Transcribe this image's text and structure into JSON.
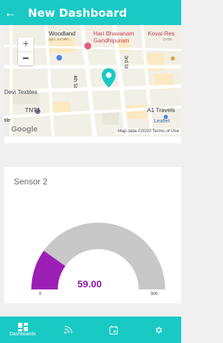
{
  "app_bar": {
    "title": "New Dashboard",
    "back_icon": "arrow-left-icon"
  },
  "map": {
    "labels": {
      "woodland": "Woodland",
      "woodland_sub": "ஹட்லாண்ட்",
      "hari_bhavanam": "Hari Bhavanam",
      "gandhipuram": "Gandhipuram",
      "kovai_res": "Kovai Res",
      "kovai_sub": "ராஸ்",
      "fourth_st": "4th St",
      "third_st": "3rd St",
      "devi_textiles": "Devi Textiles",
      "tntj": "TNTJ",
      "tile": "tile",
      "a1_travels": "A1 Travels",
      "leaflet": "Leaflet"
    },
    "zoom_in": "+",
    "zoom_out": "−",
    "google_logo": "Google",
    "attribution": "Map data ©2020   Terms of Use"
  },
  "sensor": {
    "title": "Sensor 2",
    "value": "59.00",
    "min": "0",
    "max": "300",
    "fraction": 0.1967,
    "fill_color": "#9c1fb5",
    "track_color": "#c8c8c8"
  },
  "bottom_nav": {
    "items": [
      {
        "label": "Dashboards",
        "icon": "dashboard-icon",
        "active": true
      },
      {
        "label": "",
        "icon": "rss-feed-icon",
        "active": false
      },
      {
        "label": "",
        "icon": "calendar-icon",
        "active": false
      },
      {
        "label": "",
        "icon": "settings-gear-icon",
        "active": false
      }
    ]
  },
  "colors": {
    "primary": "#19c9c4",
    "accent": "#8d1aa8"
  }
}
